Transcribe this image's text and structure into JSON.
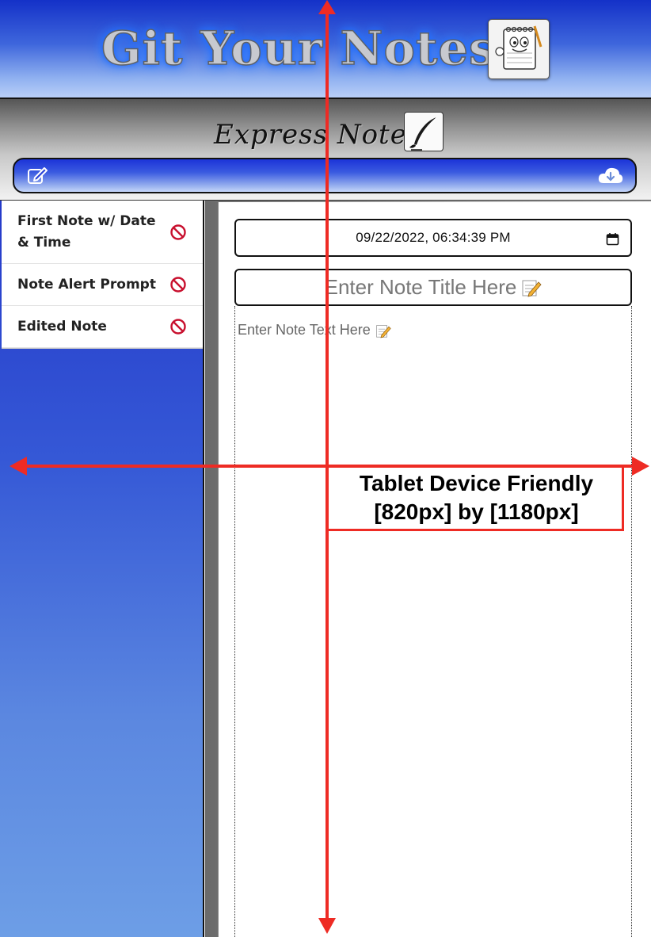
{
  "header": {
    "app_title": "Git Your Notes",
    "logo_icon": "notepad-mascot-icon",
    "subtitle": "Express Notes",
    "subtitle_icon": "quill-pen-icon"
  },
  "toolbar": {
    "new_note_icon": "edit-square-icon",
    "save_icon": "cloud-download-icon"
  },
  "notes": [
    {
      "title": "First Note w/ Date & Time",
      "delete_icon": "no-entry-icon"
    },
    {
      "title": "Note Alert Prompt",
      "delete_icon": "no-entry-icon"
    },
    {
      "title": "Edited Note",
      "delete_icon": "no-entry-icon"
    }
  ],
  "editor": {
    "datetime_value": "09/22/2022, 06:34:39 PM",
    "title_placeholder": "Enter Note Title Here",
    "text_placeholder": "Enter Note Text Here",
    "placeholder_icon": "memo-pencil-icon"
  },
  "annotation": {
    "line1": "Tablet Device Friendly",
    "line2": "[820px] by [1180px]"
  },
  "colors": {
    "banner_blue": "#1431c8",
    "arrow_red": "#ee2b24",
    "delete_red": "#c8102e"
  }
}
